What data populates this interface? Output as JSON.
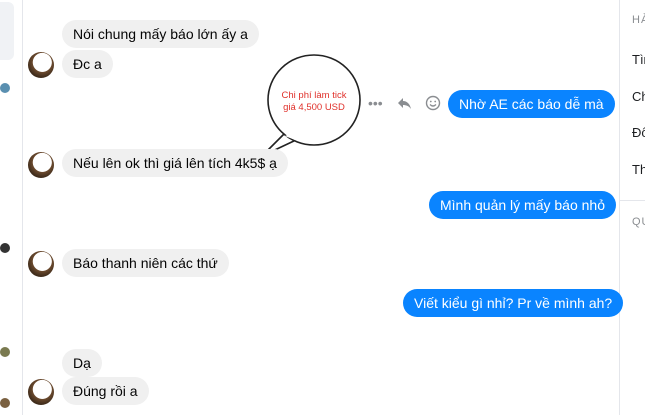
{
  "right_panel": {
    "section1_header": "HÀ",
    "items": [
      "Tìn",
      "Ch",
      "Đổ",
      "Th"
    ],
    "section2_header": "QU"
  },
  "messages": {
    "m1": "Nói chung mấy báo lớn ấy a",
    "m2": "Đc a",
    "m3": "Nhờ AE các báo dễ mà",
    "m4": "Nếu lên ok thì giá lên tích 4k5$ ạ",
    "m5": "Mình quản lý mấy báo nhỏ",
    "m6": "Báo thanh niên các thứ",
    "m7": "Viết kiểu gì nhỉ? Pr về mình ah?",
    "m8": "Dạ",
    "m9": "Đúng rồi a"
  },
  "annotation": {
    "line1": "Chi phí làm tick",
    "line2": "giá 4,500 USD"
  },
  "message_actions": {
    "more_icon": "more-horizontal-icon",
    "reply_icon": "reply-icon",
    "react_icon": "smiley-icon"
  },
  "colors": {
    "outgoing_bubble": "#0a84ff",
    "incoming_bubble": "#f0f0f0",
    "annotation_text": "#e0312b"
  }
}
